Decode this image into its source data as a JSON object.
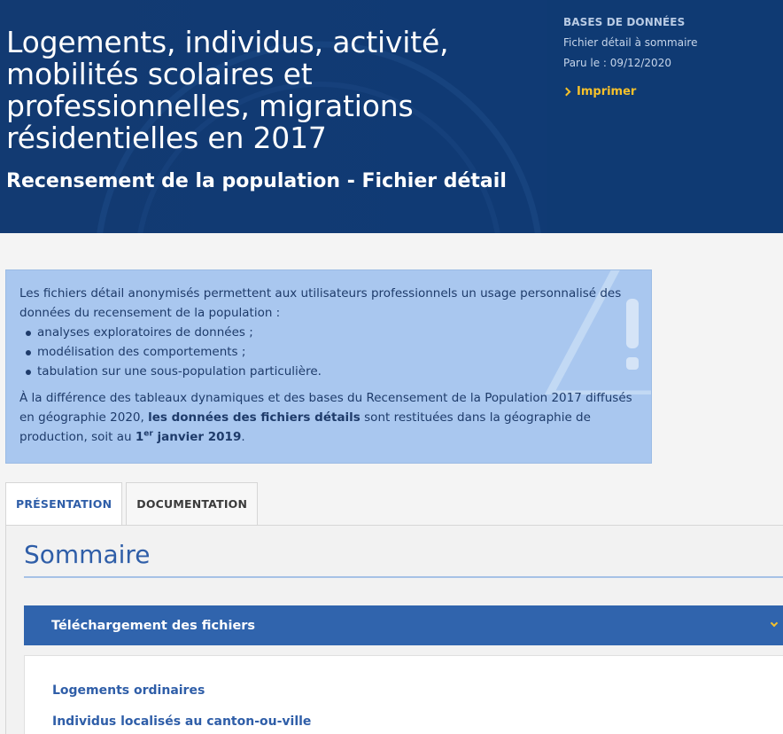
{
  "hero": {
    "title": "Logements, individus, activité, mobilités scolaires et professionnelles, migrations résidentielles en 2017",
    "subtitle": "Recensement de la population - Fichier détail",
    "bg_color": "#123a72"
  },
  "meta": {
    "type": "BASES DE DONNÉES",
    "detail": "Fichier détail à sommaire",
    "published": "Paru le : 09/12/2020",
    "print_label": "Imprimer",
    "accent_color": "#f6c12a"
  },
  "info": {
    "intro": "Les fichiers détail anonymisés permettent aux utilisateurs professionnels un usage personnalisé des données du recensement de la population :",
    "bullets": [
      "analyses exploratoires de données ;",
      "modélisation des comportements ;",
      "tabulation sur une sous-population particulière."
    ],
    "para_start": "À la différence des tableaux dynamiques et des bases du Recensement de la Population 2017 diffusés en géographie 2020, ",
    "para_bold": "les données des fichiers détails",
    "para_mid": " sont restituées dans la géographie de production, soit au ",
    "date_num": "1",
    "date_sup": "er",
    "date_rest": " janvier 2019",
    "para_end": ".",
    "bg_color": "#a9c7ef"
  },
  "tabs": [
    {
      "label": "PRÉSENTATION",
      "active": true
    },
    {
      "label": "DOCUMENTATION",
      "active": false
    }
  ],
  "panel": {
    "title": "Sommaire",
    "accordion": {
      "header": "Téléchargement des fichiers",
      "header_color": "#3064ad",
      "links": [
        "Logements ordinaires",
        "Individus localisés au canton-ou-ville"
      ]
    }
  },
  "icons": {
    "print": "chevron-right-icon",
    "accordion": "chevron-down-icon",
    "info": "warning-icon"
  }
}
